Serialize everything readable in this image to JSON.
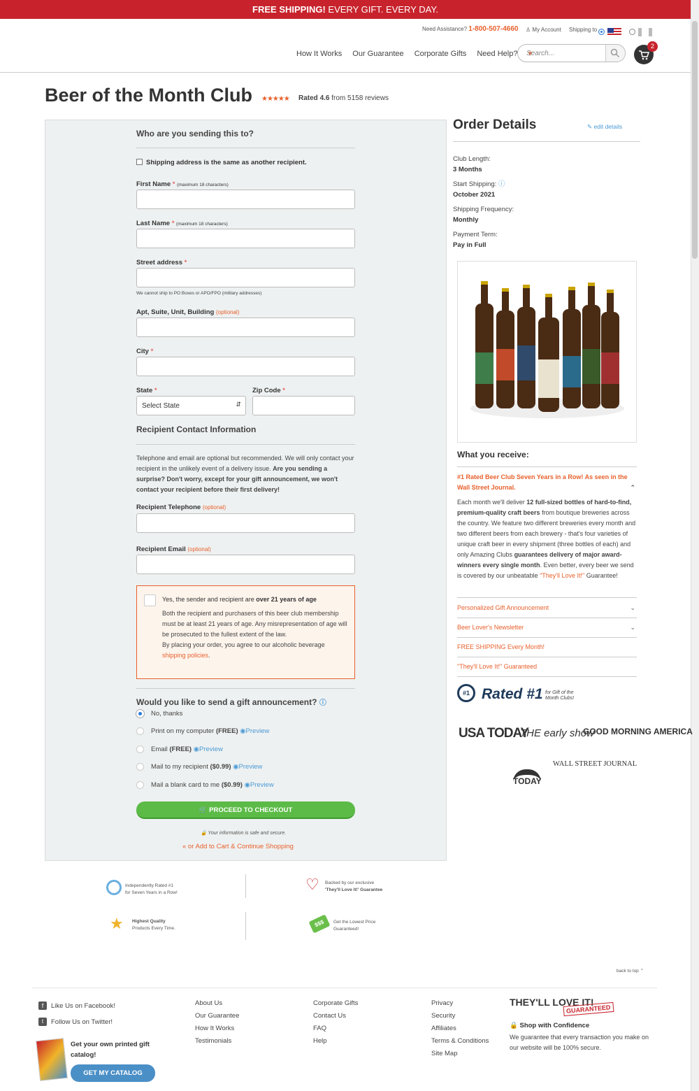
{
  "banner": {
    "bold": "FREE SHIPPING!",
    "rest": "EVERY GIFT. EVERY DAY."
  },
  "util": {
    "assist": "Need Assistance?",
    "phone": "1-800-507-4660",
    "account": "My Account",
    "ship": "Shipping to"
  },
  "nav": [
    "How It Works",
    "Our Guarantee",
    "Corporate Gifts",
    "Need Help?"
  ],
  "search": {
    "placeholder": "Search..."
  },
  "cart": {
    "count": "2"
  },
  "page": {
    "title": "Beer of the Month Club",
    "stars": "★★★★★",
    "rated_pre": "Rated",
    "rating": "4.6",
    "rated_post": "from 5158 reviews"
  },
  "form": {
    "heading": "Who are you sending this to?",
    "same_addr": "Shipping address is the same as another recipient.",
    "first_name": "First Name",
    "first_hint": "(maximum 18 characters)",
    "last_name": "Last Name",
    "last_hint": "(maximum 18 characters)",
    "street": "Street address",
    "street_note": "We cannot ship to PO Boxes or APO/FPO (military addresses)",
    "apt": "Apt, Suite, Unit, Building",
    "optional": "(optional)",
    "city": "City",
    "state": "State",
    "state_value": "Select State",
    "zip": "Zip Code",
    "contact_heading": "Recipient Contact Information",
    "contact_text": "Telephone and email are optional but recommended. We will only contact your recipient in the unlikely event of a delivery issue.",
    "contact_bold": "Are you sending a surprise? Don't worry, except for your gift announcement, we won't contact your recipient before their first delivery!",
    "phone": "Recipient Telephone",
    "email": "Recipient Email",
    "age_pre": "Yes, the sender and recipient are",
    "age_bold": "over 21 years of age",
    "age_text": "Both the recipient and purchasers of this beer club membership must be at least 21 years of age. Any misrepresentation of age will be prosecuted to the fullest extent of the law.",
    "age_text2": "By placing your order, you agree to our alcoholic beverage",
    "age_link": "shipping policies",
    "gift_heading": "Would you like to send a gift announcement?",
    "gift_opts": [
      {
        "label": "No, thanks",
        "price": "",
        "preview": ""
      },
      {
        "label": "Print on my computer",
        "price": "(FREE)",
        "preview": "Preview"
      },
      {
        "label": "Email",
        "price": "(FREE)",
        "preview": "Preview"
      },
      {
        "label": "Mail to my recipient",
        "price": "($0.99)",
        "preview": "Preview"
      },
      {
        "label": "Mail a blank card to me",
        "price": "($0.99)",
        "preview": "Preview"
      }
    ],
    "checkout": "PROCEED TO CHECKOUT",
    "secure": "Your information is safe and secure.",
    "continue": "« or Add to Cart & Continue Shopping"
  },
  "order": {
    "title": "Order Details",
    "edit": "edit details",
    "items": [
      {
        "label": "Club Length:",
        "value": "3 Months"
      },
      {
        "label": "Start Shipping:",
        "value": "October 2021"
      },
      {
        "label": "Shipping Frequency:",
        "value": "Monthly"
      },
      {
        "label": "Payment Term:",
        "value": "Pay in Full"
      }
    ]
  },
  "receive": {
    "title": "What you receive:",
    "headline": "#1 Rated Beer Club Seven Years in a Row! As seen in the Wall Street Journal.",
    "body_1": "Each month we'll deliver",
    "body_b1": "12 full-sized bottles of hard-to-find, premium-quality craft beers",
    "body_2": "from boutique breweries across the country. We feature two different breweries every month and two different beers from each brewery - that's four varieties of unique craft beer in every shipment (three bottles of each) and only Amazing Clubs",
    "body_b2": "guarantees delivery of major award-winners every single month",
    "body_3": ". Even better, every beer we send is covered by our unbeatable",
    "body_link": "\"They'll Love It!\"",
    "body_4": "Guarantee!",
    "rows": [
      "Personalized Gift Announcement",
      "Beer Lover's Newsletter",
      "FREE SHIPPING Every Month!",
      "\"They'll Love It!\" Guaranteed"
    ]
  },
  "rated1": {
    "text": "Rated",
    "num": "#1",
    "sub": "for Gift of the Month Clubs!"
  },
  "press": [
    "USA TODAY",
    "THE early show",
    "GOOD MORNING AMERICA",
    "TODAY",
    "WALL STREET JOURNAL"
  ],
  "trust": [
    {
      "l1": "Independently Rated #1",
      "l2": "for Seven Years in a Row!"
    },
    {
      "l1": "Backed by our exclusive",
      "l2": "'They'll Love It!' Guarantee"
    },
    {
      "l1": "Highest Quality",
      "l2": "Products Every Time."
    },
    {
      "l1": "Get the Lowest Price",
      "l2": "Guaranteed!"
    }
  ],
  "back_top": "back to top",
  "footer": {
    "social": [
      "Like Us on Facebook!",
      "Follow Us on Twitter!"
    ],
    "catalog": "Get your own printed gift catalog!",
    "catalog_btn": "GET MY CATALOG",
    "col1": [
      "About Us",
      "Our Guarantee",
      "How It Works",
      "Testimonials"
    ],
    "col2": [
      "Corporate Gifts",
      "Contact Us",
      "FAQ",
      "Help"
    ],
    "col3": [
      "Privacy",
      "Security",
      "Affiliates",
      "Terms & Conditions",
      "Site Map"
    ],
    "love": "THEY'LL LOVE IT!",
    "guaranteed": "GUARANTEED",
    "shop": "Shop with Confidence",
    "shop_text": "We guarantee that every transaction you make on our website will be 100% secure."
  }
}
